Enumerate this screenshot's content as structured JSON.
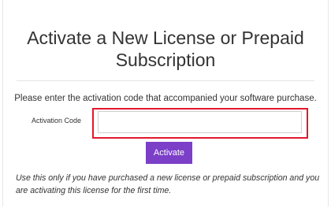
{
  "header": {
    "title": "Activate a New License or Prepaid Subscription"
  },
  "form": {
    "instruction": "Please enter the activation code that accompanied your software purchase.",
    "activation_code_label": "Activation Code",
    "activation_code_value": "",
    "activation_code_placeholder": "",
    "activate_button_label": "Activate"
  },
  "note": {
    "text": "Use this only if you have purchased a new license or prepaid subscription and you are activating this license for the first time."
  },
  "colors": {
    "button": "#7b3fc8",
    "highlight": "#e2182c"
  }
}
